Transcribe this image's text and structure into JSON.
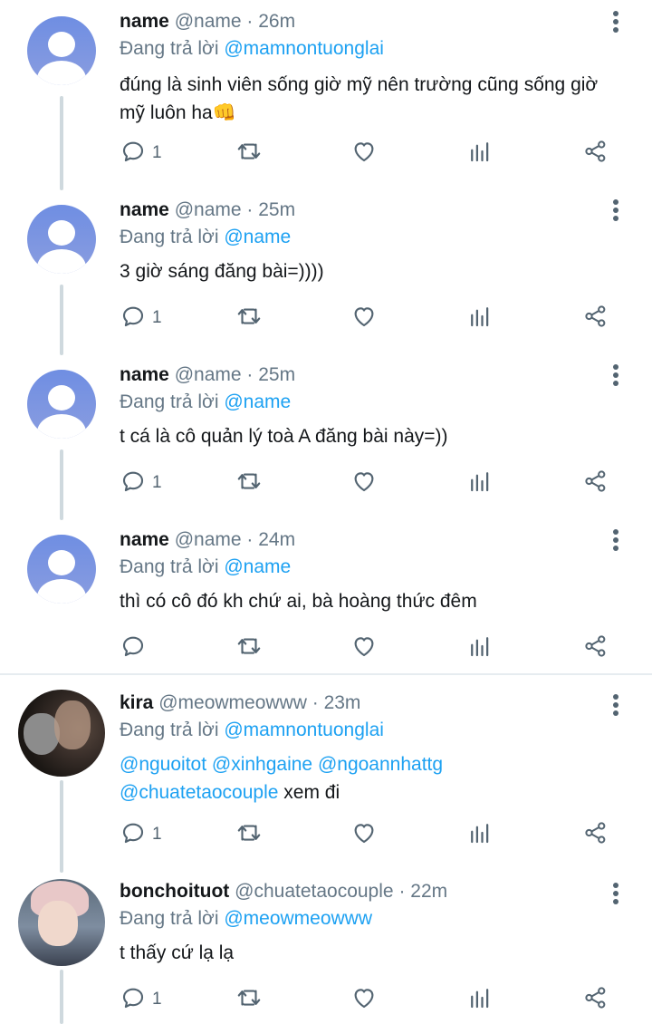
{
  "tweets": [
    {
      "name": "name",
      "handle": "@name",
      "time": "· 26m",
      "reply_prefix": "Đang trả lời",
      "reply_to": "@mamnontuonglai",
      "text_line1": "đúng là sinh viên sống giờ mỹ nên trường cũng sống giờ",
      "text_line2": "mỹ luôn ha👊",
      "reply_count": "1"
    },
    {
      "name": "name",
      "handle": "@name",
      "time": "· 25m",
      "reply_prefix": "Đang trả lời",
      "reply_to": "@name",
      "text_line1": "3 giờ sáng đăng bài=))))",
      "reply_count": "1"
    },
    {
      "name": "name",
      "handle": "@name",
      "time": "· 25m",
      "reply_prefix": "Đang trả lời",
      "reply_to": "@name",
      "text_line1": "t cá là cô quản lý toà A đăng bài này=))",
      "reply_count": "1"
    },
    {
      "name": "name",
      "handle": "@name",
      "time": "· 24m",
      "reply_prefix": "Đang trả lời",
      "reply_to": "@name",
      "text_line1": "thì có cô đó kh chứ ai, bà hoàng thức đêm",
      "reply_count": ""
    },
    {
      "name": "kira",
      "handle": "@meowmeowww",
      "time": "· 23m",
      "reply_prefix": "Đang trả lời",
      "reply_to": "@mamnontuonglai",
      "mentions_line1": "@nguoitot @xinhgaine @ngoannhattg",
      "mention_line2": "@chuatetaocouple",
      "text_after_mention": " xem đi",
      "reply_count": "1"
    },
    {
      "name": "bonchoituot",
      "handle": "@chuatetaocouple",
      "time": "· 22m",
      "reply_prefix": "Đang trả lời",
      "reply_to": "@meowmeowww",
      "text_line1": "t thấy cứ lạ lạ",
      "reply_count": "1"
    }
  ],
  "colors": {
    "link": "#1da1f2",
    "secondary_text": "#657786",
    "avatar_placeholder": "#7b93e1"
  },
  "icons": [
    "reply-icon",
    "retweet-icon",
    "like-icon",
    "stats-icon",
    "share-icon",
    "more-icon"
  ]
}
